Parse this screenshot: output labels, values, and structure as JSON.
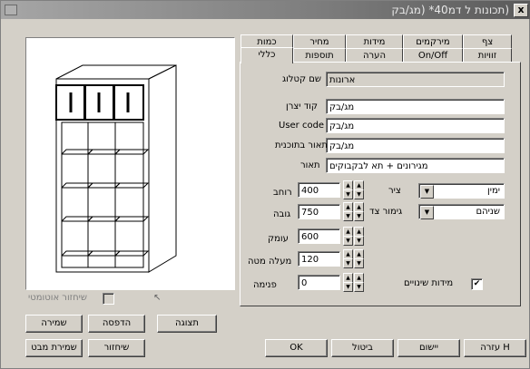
{
  "window": {
    "title": "(תכונות ל דמ40* (מג/בק",
    "close_label": "x"
  },
  "tabs_row1": [
    {
      "label": "צף"
    },
    {
      "label": "מירקמים"
    },
    {
      "label": "מידות"
    },
    {
      "label": "מחיר"
    },
    {
      "label": "כמות"
    }
  ],
  "tabs_row2": [
    {
      "label": "זוויות"
    },
    {
      "label": "On/Off"
    },
    {
      "label": "הערה"
    },
    {
      "label": "תוספות"
    },
    {
      "label": "כללי"
    }
  ],
  "fields": {
    "catalog_name_label": "שם קטלוג",
    "catalog_name_value": "ארונות",
    "maker_code_label": "קוד יצרן",
    "maker_code_value": "מג/בק",
    "user_code_label": "User code",
    "user_code_value": "מג/בק",
    "program_desc_label": "תאור בתוכנית",
    "program_desc_value": "מג/בק",
    "description_label": "תאור",
    "description_value": "מגירונים + תא לבקבוקים"
  },
  "dimensions": {
    "width_label": "רוחב",
    "width_value": "400",
    "height_label": "גובה",
    "height_value": "750",
    "depth_label": "עומק",
    "depth_value": "600",
    "elevation_label": "מעלה מטה",
    "elevation_value": "120",
    "inner_label": "פנימה",
    "inner_value": "0"
  },
  "options": {
    "axis_label": "ציר",
    "axis_value": "ימין",
    "side_finish_label": "גימור צד",
    "side_finish_value": "שניהם",
    "variable_dims_label": "מידות שינויים",
    "variable_dims_checked": true
  },
  "preview_panel": {
    "auto_rotate_label": "שיחזור אוטומטי"
  },
  "left_buttons": {
    "save": "שמירה",
    "print": "הדפסה",
    "display": "תצוגה",
    "save_as": "שמירת מבט",
    "restore": "שיחזור"
  },
  "bottom_buttons": {
    "help": "עזרה H",
    "apply": "יישום",
    "cancel": "ביטול",
    "ok": "OK"
  }
}
